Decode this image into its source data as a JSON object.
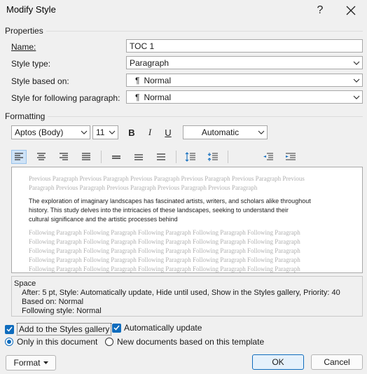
{
  "window": {
    "title": "Modify Style",
    "help_glyph": "?",
    "close_glyph": "✕"
  },
  "properties": {
    "group_label": "Properties",
    "name_label": "Name:",
    "name_value": "TOC 1",
    "style_type_label": "Style type:",
    "style_type_value": "Paragraph",
    "based_on_label": "Style based on:",
    "based_on_value": "Normal",
    "following_label": "Style for following paragraph:",
    "following_value": "Normal",
    "para_mark": "¶"
  },
  "formatting": {
    "group_label": "Formatting",
    "font": "Aptos (Body)",
    "size": "11",
    "bold": "B",
    "italic": "I",
    "underline": "U",
    "color": "Automatic"
  },
  "preview": {
    "previous": [
      "Previous Paragraph Previous Paragraph Previous Paragraph Previous Paragraph Previous Paragraph Previous",
      "Paragraph Previous Paragraph Previous Paragraph Previous Paragraph Previous Paragraph"
    ],
    "main": [
      "The exploration of imaginary landscapes has fascinated artists, writers, and scholars alike throughout",
      "history. This study delves into the intricacies of these landscapes, seeking to understand their",
      "cultural significance and the artistic processes behind"
    ],
    "following": [
      "Following Paragraph Following Paragraph Following Paragraph Following Paragraph Following Paragraph",
      "Following Paragraph Following Paragraph Following Paragraph Following Paragraph Following Paragraph",
      "Following Paragraph Following Paragraph Following Paragraph Following Paragraph Following Paragraph",
      "Following Paragraph Following Paragraph Following Paragraph Following Paragraph Following Paragraph",
      "Following Paragraph Following Paragraph Following Paragraph Following Paragraph Following Paragraph"
    ]
  },
  "description": {
    "line1": "Space",
    "line2": "After:  5 pt, Style: Automatically update, Hide until used, Show in the Styles gallery, Priority: 40",
    "line3": "Based on: Normal",
    "line4": "Following style: Normal"
  },
  "options": {
    "add_gallery": "Add to the Styles gallery",
    "add_gallery_checked": true,
    "auto_update": "Automatically update",
    "auto_update_checked": true,
    "only_doc": "Only in this document",
    "only_doc_selected": true,
    "new_docs": "New documents based on this template",
    "new_docs_selected": false
  },
  "buttons": {
    "format": "Format",
    "ok": "OK",
    "cancel": "Cancel"
  },
  "colors": {
    "accent": "#0f6cbd",
    "preview_grey": "#b0b0b0"
  }
}
